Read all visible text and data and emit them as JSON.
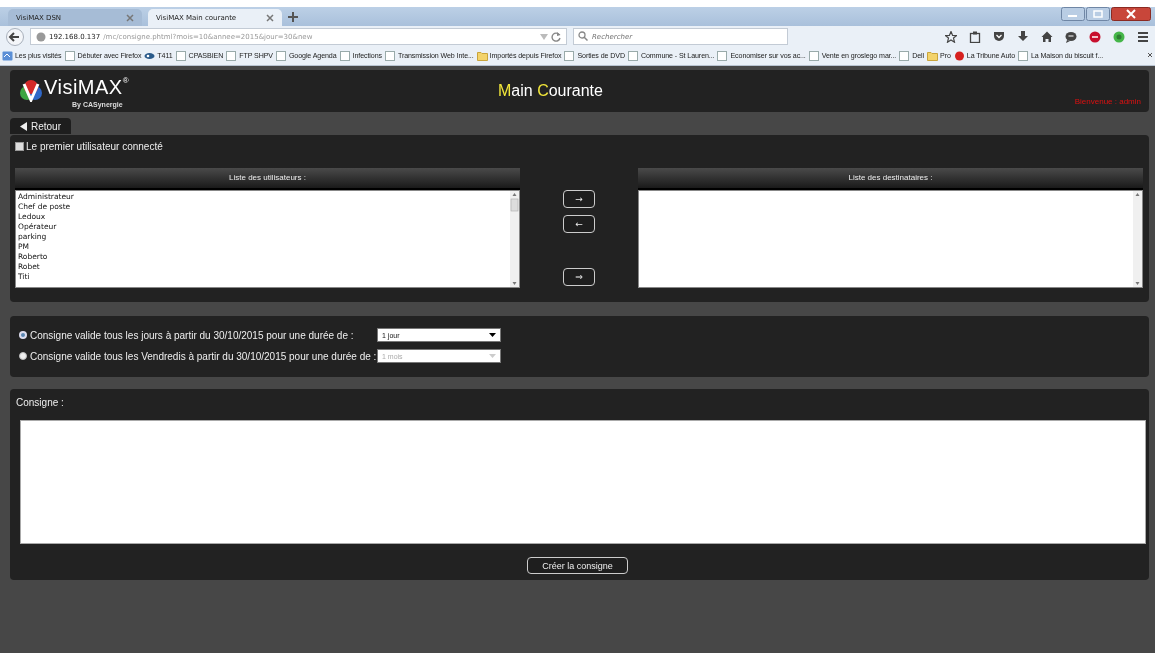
{
  "browser": {
    "tabs": [
      {
        "title": "VisiMAX DSN",
        "selected": false
      },
      {
        "title": "VisiMAX Main courante",
        "selected": true
      }
    ],
    "url": {
      "host": "192.168.0.137",
      "path": "/mc/consigne.phtml?mois=10&annee=2015&jour=30&new"
    },
    "search": {
      "placeholder": "Rechercher"
    },
    "bookmarks": [
      {
        "label": "Les plus visités",
        "kind": "history"
      },
      {
        "label": "Débuter avec Firefox",
        "kind": "page"
      },
      {
        "label": "T411",
        "kind": "glasses"
      },
      {
        "label": "CPASBIEN",
        "kind": "page"
      },
      {
        "label": "FTP SHPV",
        "kind": "page"
      },
      {
        "label": "Google Agenda",
        "kind": "page"
      },
      {
        "label": "Infections",
        "kind": "page"
      },
      {
        "label": "Transmission Web Inte...",
        "kind": "page"
      },
      {
        "label": "Importés depuis Firefox",
        "kind": "folder"
      },
      {
        "label": "Sorties de DVD",
        "kind": "page"
      },
      {
        "label": "Commune - St Lauren...",
        "kind": "page"
      },
      {
        "label": "Economiser sur vos ac...",
        "kind": "page"
      },
      {
        "label": "Vente en groslego mar...",
        "kind": "page"
      },
      {
        "label": "Dell",
        "kind": "page"
      },
      {
        "label": "Pro",
        "kind": "folder"
      },
      {
        "label": "La Tribune Auto",
        "kind": "dot"
      },
      {
        "label": "La Maison du biscuit f...",
        "kind": "page"
      }
    ]
  },
  "header": {
    "logo": {
      "name": "VisiMAX",
      "mark": "®",
      "tagline": "By CASynergie"
    },
    "title": [
      {
        "text": "M",
        "kind": "accent"
      },
      {
        "text": "ain ",
        "kind": "plain"
      },
      {
        "text": "C",
        "kind": "accent"
      },
      {
        "text": "ourante",
        "kind": "plain"
      }
    ],
    "welcome": "Bienvenue : admin"
  },
  "nav": {
    "back": "Retour"
  },
  "first_user": {
    "label": "Le premier utilisateur connecté",
    "checked": false
  },
  "users": {
    "header": "Liste des utilisateurs :",
    "items": [
      "Administrateur",
      "Chef de poste",
      "Ledoux",
      "Opérateur",
      "parking",
      "PM",
      "Roberto",
      "Robet",
      "Titi"
    ]
  },
  "transfer_buttons": [
    {
      "label": "→",
      "kind": "add"
    },
    {
      "label": "←",
      "kind": "remove"
    },
    {
      "label": "⇒",
      "kind": "all"
    }
  ],
  "recipients": {
    "header": "Liste des destinataires :"
  },
  "options": [
    {
      "label": "Consigne valide tous les jours à partir du 30/10/2015 pour une durée de :",
      "selected": true,
      "duration": "1 jour",
      "disabled": false
    },
    {
      "label": "Consigne valide tous les Vendredis à partir du 30/10/2015 pour une durée de :",
      "selected": false,
      "duration": "1 mois",
      "disabled": true
    }
  ],
  "consigne": {
    "label": "Consigne :"
  },
  "submit": "Créer la consigne"
}
